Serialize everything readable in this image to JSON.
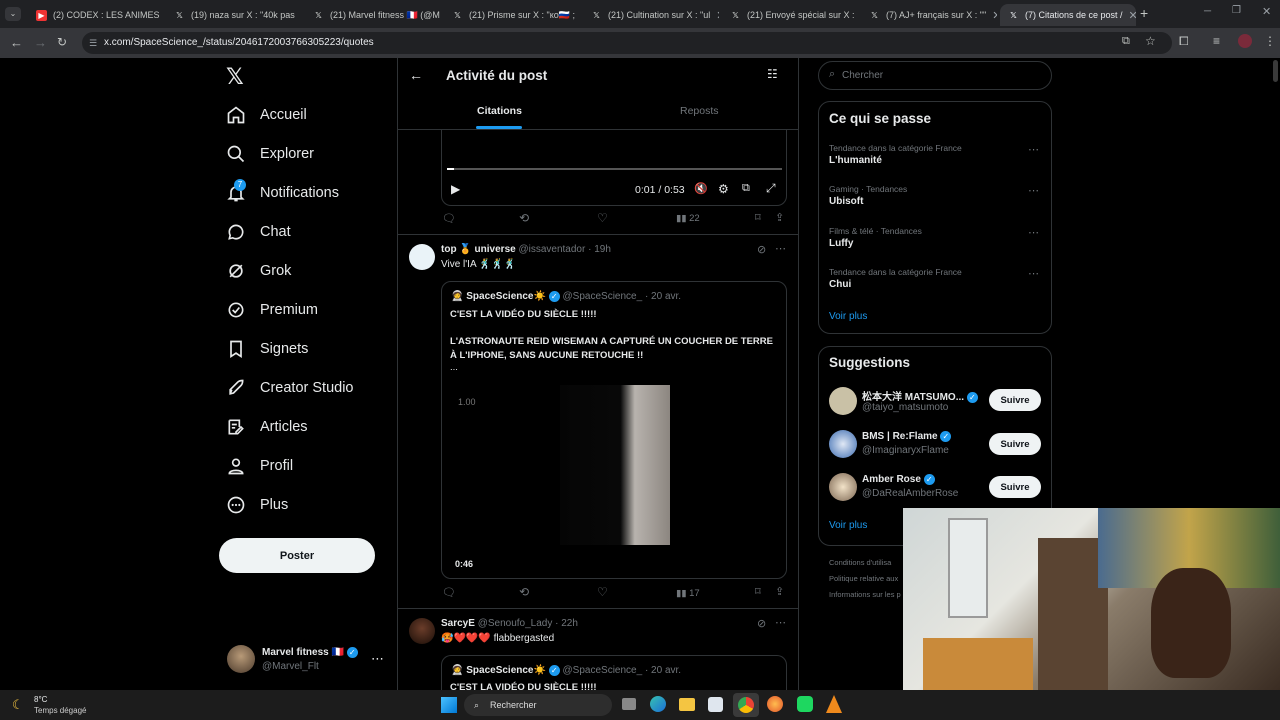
{
  "browser": {
    "tabs": [
      {
        "title": "(2) CODEX : LES ANIMES",
        "fav": "youtube"
      },
      {
        "title": "(19) naza sur X : \"40k pas",
        "fav": "x"
      },
      {
        "title": "(21) Marvel fitness 🇫🇷 (@M",
        "fav": "x"
      },
      {
        "title": "(21) Prisme sur X : \"ко🇷🇺 ;",
        "fav": "x"
      },
      {
        "title": "(21) Cultination sur X : \"ul",
        "fav": "x"
      },
      {
        "title": "(21) Envoyé spécial sur X :",
        "fav": "x"
      },
      {
        "title": "(7) AJ+ français sur X : \"\"",
        "fav": "x"
      },
      {
        "title": "(7) Citations de ce post /",
        "fav": "x"
      }
    ],
    "url": "x.com/SpaceScience_/status/2046172003766305223/quotes"
  },
  "nav": {
    "items": [
      "Accueil",
      "Explorer",
      "Notifications",
      "Chat",
      "Grok",
      "Premium",
      "Signets",
      "Creator Studio",
      "Articles",
      "Profil",
      "Plus"
    ],
    "notif_badge": "7",
    "post_button": "Poster",
    "account": {
      "name": "Marvel fitness 🇫🇷",
      "handle": "@Marvel_Flt"
    }
  },
  "header": {
    "title": "Activité du post",
    "tabs": [
      "Citations",
      "Reposts"
    ]
  },
  "video1": {
    "time": "0:01 / 0:53"
  },
  "tweet1_actions": {
    "views": "22"
  },
  "tweet2": {
    "name": "top 🏅 universe",
    "handle": "@issaventador",
    "time": "· 19h",
    "text": "Vive l'IA 🕺🕺🕺",
    "quote": {
      "name": "🧑‍🚀 SpaceScience☀️",
      "handle": "@SpaceScience_",
      "time": "· 20 avr.",
      "line1": "C'EST LA VIDÉO DU SIÈCLE !!!!!",
      "line2": "L'ASTRONAUTE REID WISEMAN A CAPTURÉ UN COUCHER DE TERRE À L'IPHONE, SANS AUCUNE RETOUCHE !!",
      "more": "...",
      "overlay": "1.00",
      "duration": "0:46"
    },
    "views": "17"
  },
  "tweet3": {
    "name": "SarcyE",
    "handle": "@Senoufo_Lady",
    "time": "· 22h",
    "text": "🥵❤️❤️❤️ flabbergasted",
    "quote": {
      "name": "🧑‍🚀 SpaceScience☀️",
      "handle": "@SpaceScience_",
      "time": "· 20 avr.",
      "line1": "C'EST LA VIDÉO DU SIÈCLE !!!!!"
    }
  },
  "search": {
    "placeholder": "Chercher"
  },
  "trends": {
    "title": "Ce qui se passe",
    "items": [
      {
        "meta": "Tendance dans la catégorie France",
        "name": "L'humanité"
      },
      {
        "meta": "Gaming · Tendances",
        "name": "Ubisoft"
      },
      {
        "meta": "Films & télé · Tendances",
        "name": "Luffy"
      },
      {
        "meta": "Tendance dans la catégorie France",
        "name": "Chui"
      }
    ],
    "more": "Voir plus"
  },
  "suggestions": {
    "title": "Suggestions",
    "items": [
      {
        "name": "松本大洋 MATSUMO...",
        "handle": "@taiyo_matsumoto",
        "button": "Suivre"
      },
      {
        "name": "BMS | Re:Flame",
        "handle": "@ImaginaryxFlame",
        "button": "Suivre"
      },
      {
        "name": "Amber Rose",
        "handle": "@DaRealAmberRose",
        "button": "Suivre"
      }
    ],
    "more": "Voir plus"
  },
  "footer": [
    "Conditions d'utilisa",
    "Politique relative aux",
    "Informations sur les p"
  ],
  "taskbar": {
    "weather_temp": "8°C",
    "weather_desc": "Temps dégagé",
    "search": "Rechercher"
  }
}
